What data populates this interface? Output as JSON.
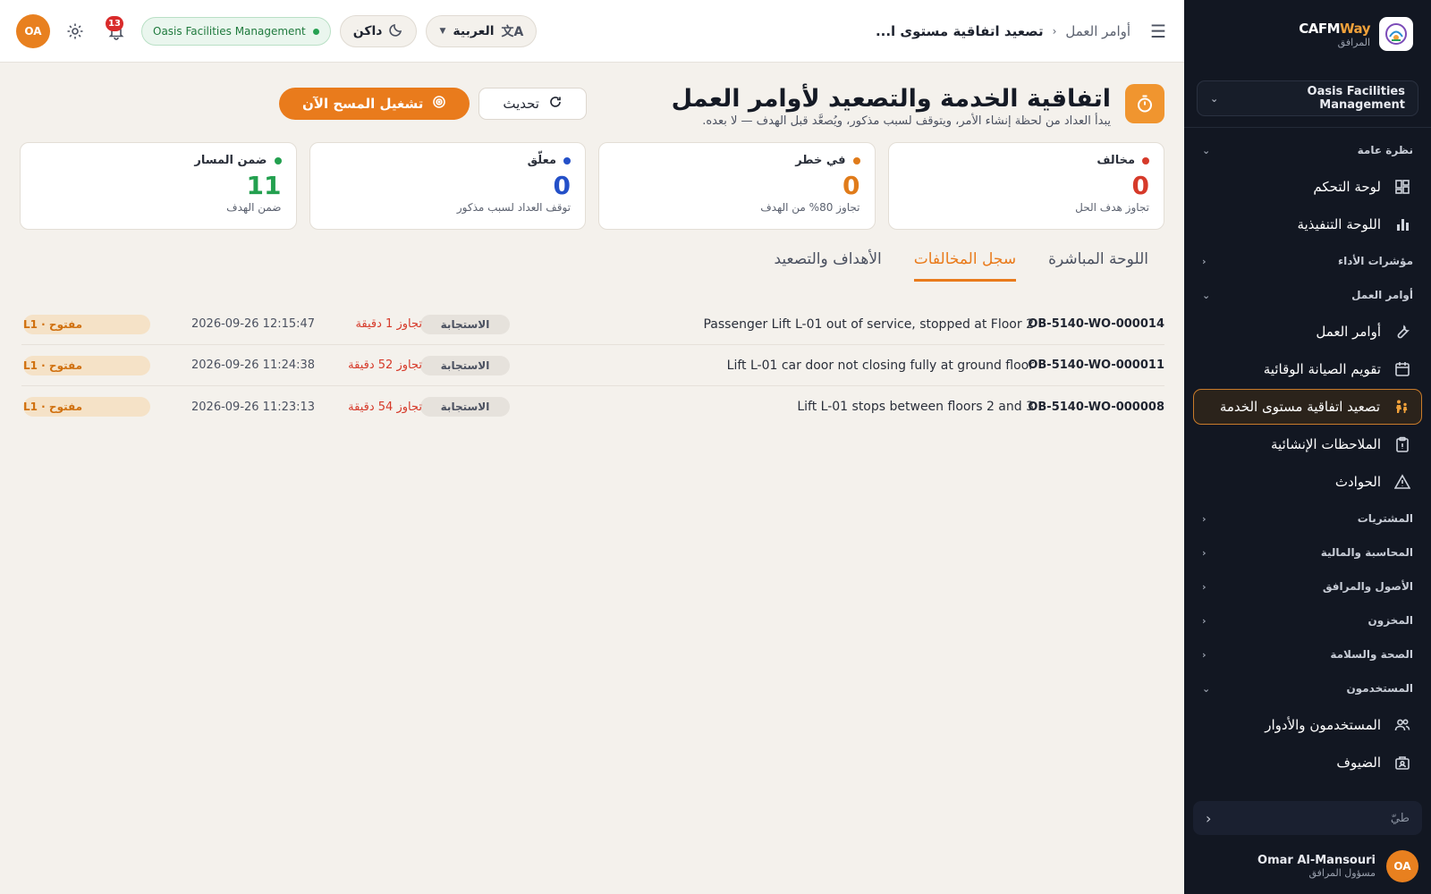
{
  "brand": {
    "name_a": "CAFM",
    "name_b": "Way",
    "subtitle": "المرافق"
  },
  "sidebar": {
    "org": "Oasis Facilities Management",
    "sections": [
      {
        "label": "نظرة عامة",
        "items": [
          {
            "label": "لوحة التحكم",
            "icon": "dashboard-icon"
          },
          {
            "label": "اللوحة التنفيذية",
            "icon": "bar-chart-icon"
          }
        ]
      },
      {
        "label": "مؤشرات الأداء",
        "items": []
      },
      {
        "label": "أوامر العمل",
        "items": [
          {
            "label": "أوامر العمل",
            "icon": "wrench-icon"
          },
          {
            "label": "تقويم الصيانة الوقائية",
            "icon": "calendar-icon"
          },
          {
            "label": "تصعيد اتفاقية مستوى الخدمة",
            "icon": "escalation-icon",
            "active": true
          },
          {
            "label": "الملاحظات الإنشائية",
            "icon": "clipboard-icon"
          },
          {
            "label": "الحوادث",
            "icon": "warning-icon"
          }
        ]
      },
      {
        "label": "المشتريات",
        "items": []
      },
      {
        "label": "المحاسبة والمالية",
        "items": []
      },
      {
        "label": "الأصول والمرافق",
        "items": []
      },
      {
        "label": "المخزون",
        "items": []
      },
      {
        "label": "الصحة والسلامة",
        "items": []
      },
      {
        "label": "المستخدمون",
        "items": [
          {
            "label": "المستخدمون والأدوار",
            "icon": "users-icon"
          },
          {
            "label": "الضيوف",
            "icon": "guests-icon"
          }
        ]
      }
    ],
    "collapse_label": "طيّ",
    "user": {
      "initials": "OA",
      "name": "Omar Al-Mansouri",
      "role": "مسؤول المرافق"
    }
  },
  "topbar": {
    "breadcrumb_parent": "أوامر العمل",
    "breadcrumb_current": "تصعيد اتفاقية مستوى ا...",
    "language": "العربية",
    "theme": "داكن",
    "org_pill": "Oasis Facilities Management",
    "notifications": "13",
    "avatar": "OA"
  },
  "header": {
    "title": "اتفاقية الخدمة والتصعيد لأوامر العمل",
    "subtitle": "يبدأ العداد من لحظة إنشاء الأمر، ويتوقف لسبب مذكور، ويُصعَّد قبل الهدف — لا بعده.",
    "refresh_label": "تحديث",
    "scan_label": "تشغيل المسح الآن"
  },
  "cards": [
    {
      "label": "مخالف",
      "value": "0",
      "desc": "تجاوز هدف الحل",
      "color": "#d63a2a"
    },
    {
      "label": "في خطر",
      "value": "0",
      "desc": "تجاوز 80% من الهدف",
      "color": "#e07b1a"
    },
    {
      "label": "معلّق",
      "value": "0",
      "desc": "توقف العداد لسبب مذكور",
      "color": "#2450c8"
    },
    {
      "label": "ضمن المسار",
      "value": "11",
      "desc": "ضمن الهدف",
      "color": "#23a04f"
    }
  ],
  "tabs": [
    {
      "label": "اللوحة المباشرة"
    },
    {
      "label": "سجل المخالفات",
      "active": true
    },
    {
      "label": "الأهداف والتصعيد"
    }
  ],
  "breaches": [
    {
      "id": "OB-5140-WO-000014",
      "title": "Passenger Lift L-01 out of service, stopped at Floor 2",
      "type": "الاستجابة",
      "over": "تجاوز 1 دقيقة",
      "time": "2026-09-26 12:15:47",
      "status": "مفتوح · L1"
    },
    {
      "id": "OB-5140-WO-000011",
      "title": "Lift L-01 car door not closing fully at ground floor",
      "type": "الاستجابة",
      "over": "تجاوز 52 دقيقة",
      "time": "2026-09-26 11:24:38",
      "status": "مفتوح · L1"
    },
    {
      "id": "OB-5140-WO-000008",
      "title": "Lift L-01 stops between floors 2 and 3",
      "type": "الاستجابة",
      "over": "تجاوز 54 دقيقة",
      "time": "2026-09-26 11:23:13",
      "status": "مفتوح · L1"
    }
  ]
}
